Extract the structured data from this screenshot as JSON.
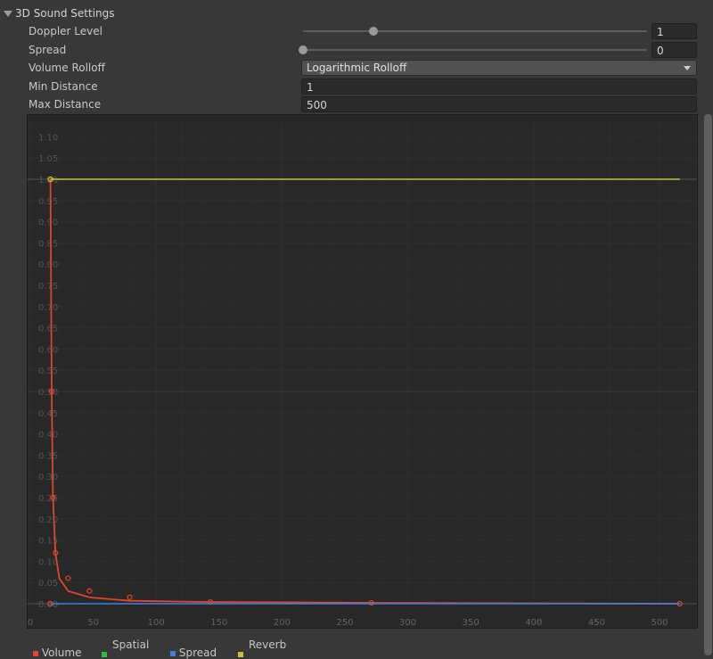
{
  "section": {
    "title": "3D Sound Settings"
  },
  "settings": {
    "doppler": {
      "label": "Doppler Level",
      "value": "1",
      "fraction": 0.205
    },
    "spread": {
      "label": "Spread",
      "value": "0",
      "fraction": 0.0
    },
    "rolloff": {
      "label": "Volume Rolloff",
      "value": "Logarithmic Rolloff"
    },
    "min_distance": {
      "label": "Min Distance",
      "value": "1"
    },
    "max_distance": {
      "label": "Max Distance",
      "value": "500"
    }
  },
  "legend": {
    "volume": {
      "label": "Volume",
      "color": "#e0452f"
    },
    "spatial": {
      "label": "Spatial",
      "color": "#2fbf3a"
    },
    "spread": {
      "label": "Spread",
      "color": "#3f7fe0"
    },
    "reverb": {
      "label": "Reverb",
      "color": "#c9c23a"
    }
  },
  "chart_data": {
    "type": "line",
    "title": "",
    "xlabel": "",
    "ylabel": "",
    "xlim": [
      0,
      520
    ],
    "ylim": [
      0,
      1.1
    ],
    "xticks": [
      "0",
      "50",
      "100",
      "150",
      "200",
      "250",
      "300",
      "350",
      "400",
      "450",
      "500"
    ],
    "yticks": [
      "0.00",
      "0.05",
      "0.10",
      "0.15",
      "0.20",
      "0.25",
      "0.30",
      "0.35",
      "0.40",
      "0.45",
      "0.50",
      "0.55",
      "0.60",
      "0.65",
      "0.70",
      "0.75",
      "0.80",
      "0.85",
      "0.90",
      "0.95",
      "1.00",
      "1.05",
      "1.10"
    ],
    "series": [
      {
        "name": "Volume",
        "color": "#e0452f",
        "x": [
          16,
          17,
          18,
          20,
          23,
          30,
          47,
          79,
          143,
          271,
          516
        ],
        "y": [
          1.0,
          0.5,
          0.25,
          0.12,
          0.06,
          0.03,
          0.015,
          0.007,
          0.004,
          0.002,
          0.0
        ],
        "keys_x": [
          16,
          17,
          18,
          20,
          30,
          47,
          79,
          143,
          271,
          516
        ],
        "keys_y": [
          1.0,
          0.5,
          0.25,
          0.12,
          0.06,
          0.03,
          0.015,
          0.004,
          0.002,
          0.0
        ]
      },
      {
        "name": "Spread",
        "color": "#3f7fe0",
        "x": [
          16,
          516
        ],
        "y": [
          0.0,
          0.0
        ],
        "keys_x": [
          16
        ],
        "keys_y": [
          0.0
        ]
      },
      {
        "name": "Reverb",
        "color": "#c9c23a",
        "x": [
          16,
          516
        ],
        "y": [
          1.0,
          1.0
        ],
        "keys_x": [
          16
        ],
        "keys_y": [
          1.0
        ]
      }
    ]
  }
}
